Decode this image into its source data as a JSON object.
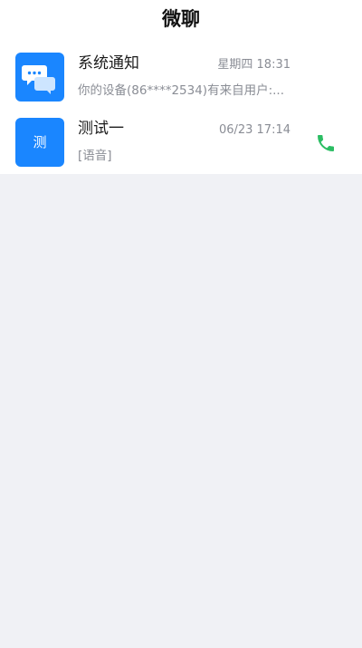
{
  "header": {
    "title": "微聊"
  },
  "conversations": [
    {
      "name": "系统通知",
      "time": "星期四 18:31",
      "preview": "你的设备(86****2534)有来自用户:...",
      "avatar_icon": "chat-bubbles-icon",
      "avatar_color": "#1a86ff"
    },
    {
      "name": "测试一",
      "time": "06/23 17:14",
      "preview": "[语音]",
      "avatar_text": "测",
      "avatar_color": "#1a86ff",
      "action_icon": "phone-icon",
      "action_color": "#2bbd63"
    }
  ],
  "colors": {
    "background": "#f0f1f5",
    "surface": "#ffffff",
    "text_primary": "#1c1c1c",
    "text_secondary": "#8a8d95"
  }
}
